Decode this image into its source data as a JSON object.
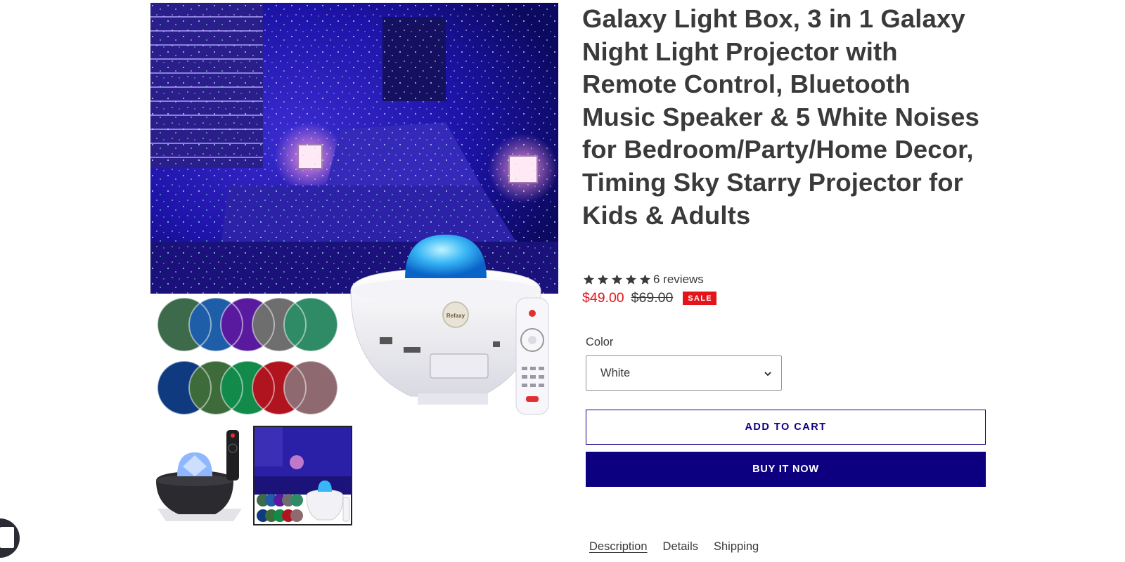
{
  "product": {
    "title": "Galaxy Light Box, 3 in 1 Galaxy Night Light Projector with Remote Control, Bluetooth Music Speaker & 5 White Noises for Bedroom/Party/Home Decor, Timing Sky Starry Projector for Kids & Adults",
    "rating": {
      "stars": 5,
      "reviews_label": "6 reviews"
    },
    "price": {
      "sale": "$49.00",
      "regular": "$69.00",
      "badge": "SALE"
    },
    "color_option": {
      "label": "Color",
      "selected": "White"
    },
    "buttons": {
      "add_to_cart": "ADD TO CART",
      "buy_now": "BUY IT NOW"
    },
    "tabs": [
      {
        "label": "Description",
        "active": true
      },
      {
        "label": "Details",
        "active": false
      },
      {
        "label": "Shipping",
        "active": false
      }
    ]
  },
  "gallery": {
    "main_image": "galaxy-projector-bedroom-photo",
    "thumbnails": [
      {
        "image": "black-projector-with-remote",
        "selected": false
      },
      {
        "image": "white-projector-bedroom-photo",
        "selected": true
      }
    ],
    "device_brand_text": "Refaxy"
  },
  "colors": {
    "title": "#3a3a3a",
    "sale_price": "#e4141b",
    "badge": "#e4141b",
    "primary_button": "#0d0080",
    "star": "#3a3a3a"
  },
  "icons": {
    "star": "star-icon",
    "select_arrow": "chevron-down-icon",
    "chat": "chat-icon"
  }
}
